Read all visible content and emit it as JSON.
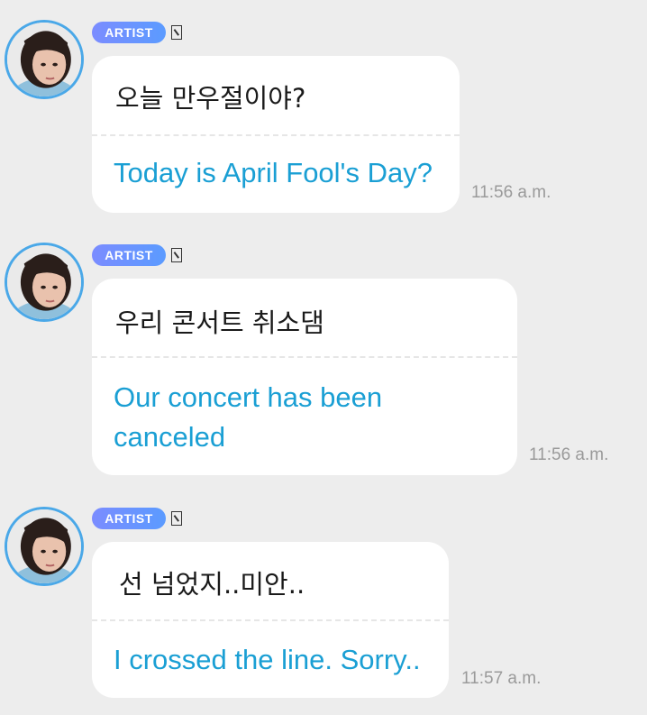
{
  "messages": [
    {
      "badge": "ARTIST",
      "original": "오늘 만우절이야?",
      "translation": "Today is April Fool's Day?",
      "time": "11:56 a.m."
    },
    {
      "badge": "ARTIST",
      "original": "우리 콘서트 취소댐",
      "translation": "Our concert has been canceled",
      "time": "11:56 a.m."
    },
    {
      "badge": "ARTIST",
      "original": "선 넘었지..미안..",
      "translation": "I crossed the line. Sorry..",
      "time": "11:57 a.m."
    }
  ],
  "colors": {
    "background": "#ededed",
    "bubble": "#ffffff",
    "translation_text": "#1a9fd4",
    "avatar_ring": "#4aa8e8",
    "badge": "#6b93ff"
  },
  "icons": {
    "avatar": "profile-photo",
    "badge_mark": "missing-glyph-box"
  }
}
